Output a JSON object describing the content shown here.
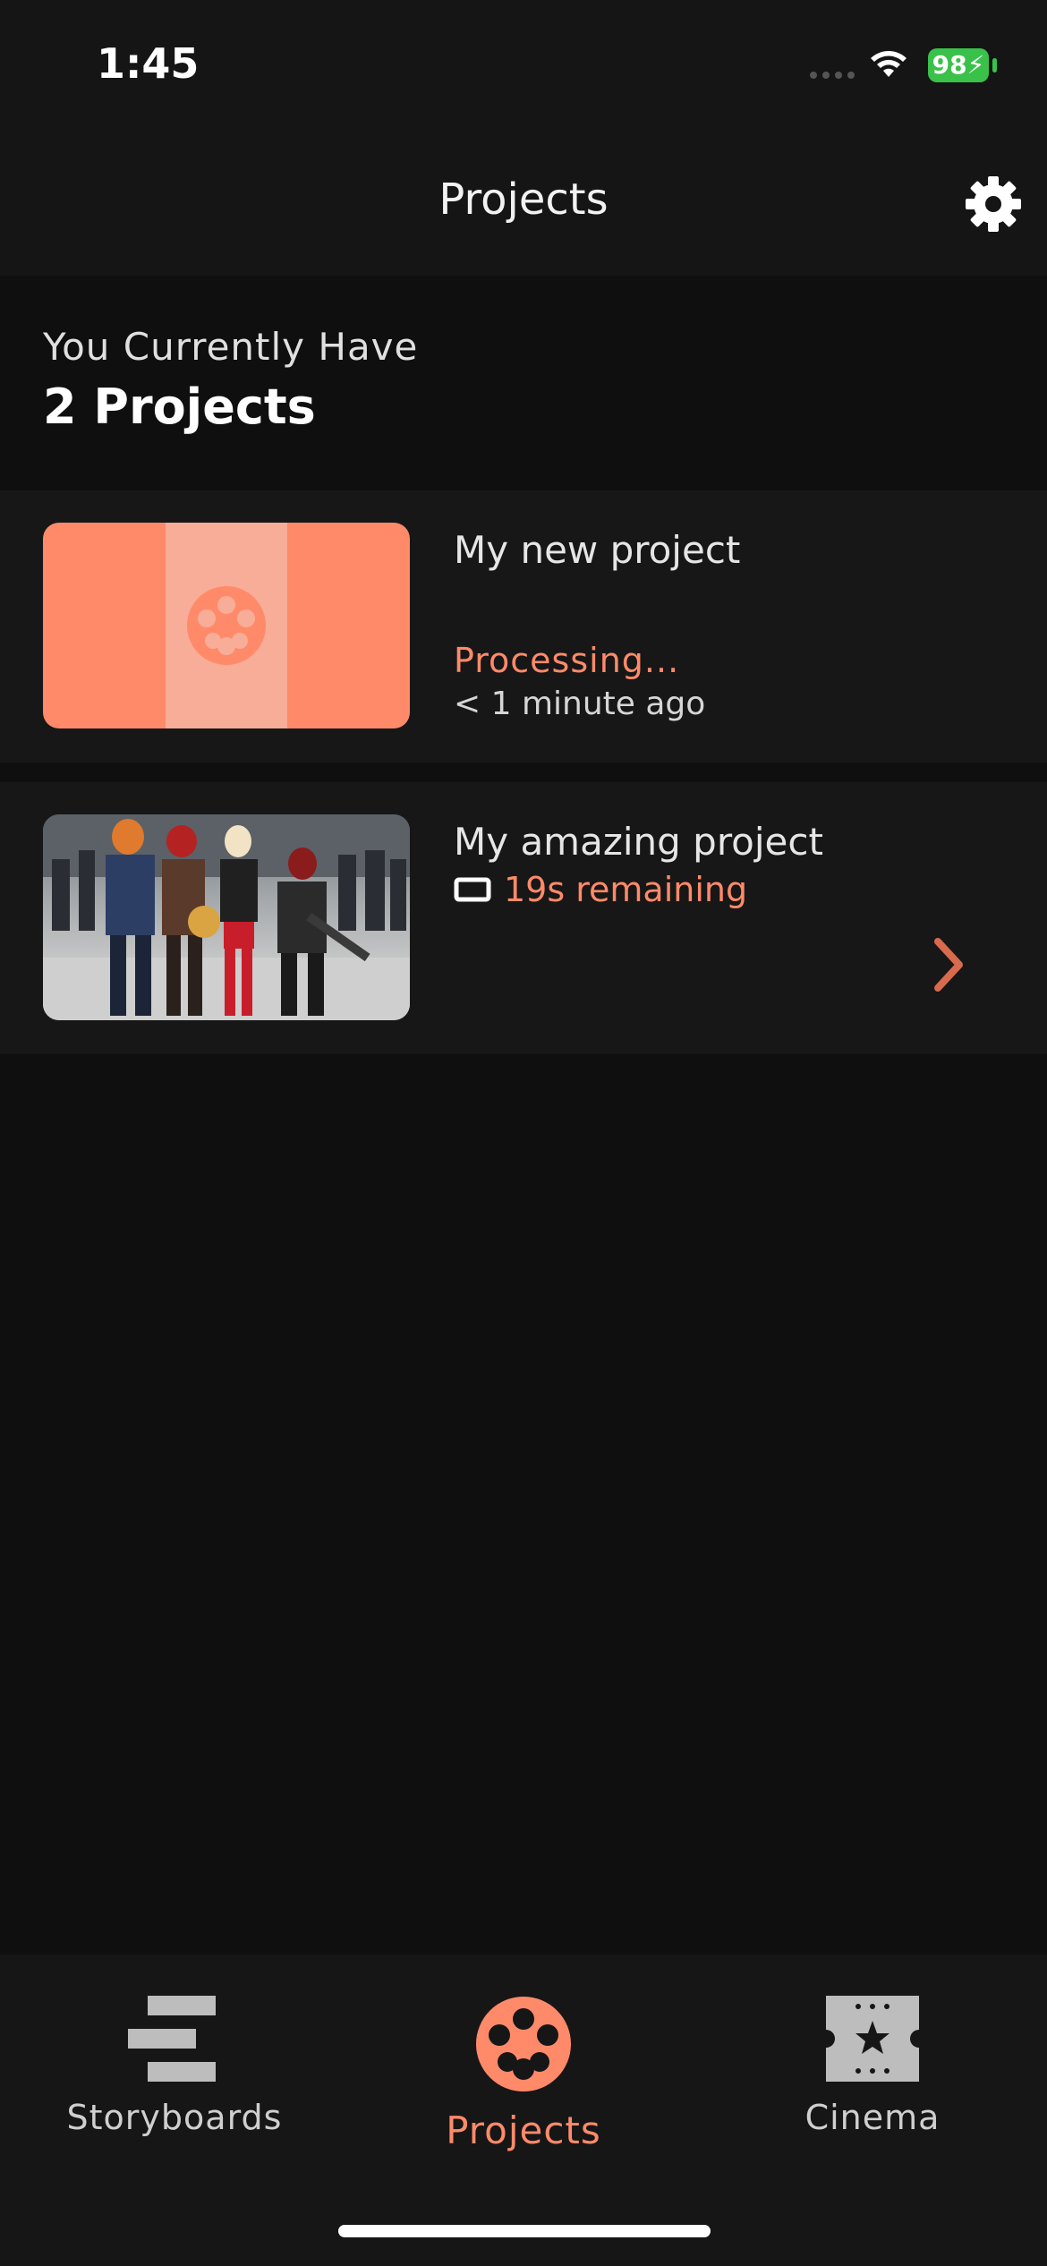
{
  "status_bar": {
    "time": "1:45",
    "battery": "98"
  },
  "nav": {
    "title": "Projects",
    "settings_icon": "gear-icon"
  },
  "summary": {
    "label": "You Currently Have",
    "count": "2 Projects"
  },
  "projects": [
    {
      "title": "My new project",
      "status": "Processing...",
      "time_ago": "< 1 minute ago",
      "thumbnail_icon": "film-reel-icon"
    },
    {
      "title": "My amazing project",
      "remaining": "19s remaining",
      "remaining_icon": "rectangle-icon",
      "chevron_icon": "chevron-right-icon"
    }
  ],
  "tabs": [
    {
      "label": "Storyboards",
      "icon": "storyboard-icon",
      "active": false
    },
    {
      "label": "Projects",
      "icon": "film-reel-icon",
      "active": true
    },
    {
      "label": "Cinema",
      "icon": "cinema-ticket-icon",
      "active": false
    }
  ],
  "colors": {
    "accent": "#ff8a6a",
    "background": "#0f0f0f",
    "card": "#171717",
    "battery": "#3ac14a"
  }
}
